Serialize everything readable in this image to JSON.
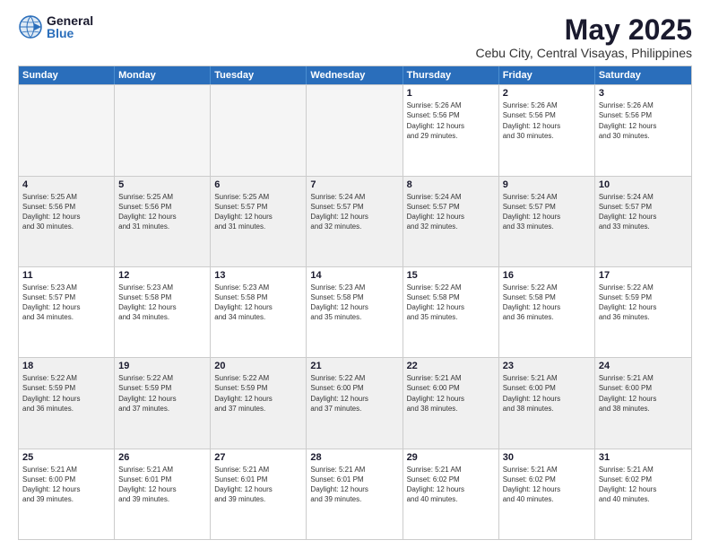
{
  "logo": {
    "general": "General",
    "blue": "Blue"
  },
  "title": "May 2025",
  "subtitle": "Cebu City, Central Visayas, Philippines",
  "days": [
    "Sunday",
    "Monday",
    "Tuesday",
    "Wednesday",
    "Thursday",
    "Friday",
    "Saturday"
  ],
  "weeks": [
    [
      {
        "day": "",
        "empty": true
      },
      {
        "day": "",
        "empty": true
      },
      {
        "day": "",
        "empty": true
      },
      {
        "day": "",
        "empty": true
      },
      {
        "day": "1",
        "info": "Sunrise: 5:26 AM\nSunset: 5:56 PM\nDaylight: 12 hours\nand 29 minutes."
      },
      {
        "day": "2",
        "info": "Sunrise: 5:26 AM\nSunset: 5:56 PM\nDaylight: 12 hours\nand 30 minutes."
      },
      {
        "day": "3",
        "info": "Sunrise: 5:26 AM\nSunset: 5:56 PM\nDaylight: 12 hours\nand 30 minutes."
      }
    ],
    [
      {
        "day": "4",
        "info": "Sunrise: 5:25 AM\nSunset: 5:56 PM\nDaylight: 12 hours\nand 30 minutes."
      },
      {
        "day": "5",
        "info": "Sunrise: 5:25 AM\nSunset: 5:56 PM\nDaylight: 12 hours\nand 31 minutes."
      },
      {
        "day": "6",
        "info": "Sunrise: 5:25 AM\nSunset: 5:57 PM\nDaylight: 12 hours\nand 31 minutes."
      },
      {
        "day": "7",
        "info": "Sunrise: 5:24 AM\nSunset: 5:57 PM\nDaylight: 12 hours\nand 32 minutes."
      },
      {
        "day": "8",
        "info": "Sunrise: 5:24 AM\nSunset: 5:57 PM\nDaylight: 12 hours\nand 32 minutes."
      },
      {
        "day": "9",
        "info": "Sunrise: 5:24 AM\nSunset: 5:57 PM\nDaylight: 12 hours\nand 33 minutes."
      },
      {
        "day": "10",
        "info": "Sunrise: 5:24 AM\nSunset: 5:57 PM\nDaylight: 12 hours\nand 33 minutes."
      }
    ],
    [
      {
        "day": "11",
        "info": "Sunrise: 5:23 AM\nSunset: 5:57 PM\nDaylight: 12 hours\nand 34 minutes."
      },
      {
        "day": "12",
        "info": "Sunrise: 5:23 AM\nSunset: 5:58 PM\nDaylight: 12 hours\nand 34 minutes."
      },
      {
        "day": "13",
        "info": "Sunrise: 5:23 AM\nSunset: 5:58 PM\nDaylight: 12 hours\nand 34 minutes."
      },
      {
        "day": "14",
        "info": "Sunrise: 5:23 AM\nSunset: 5:58 PM\nDaylight: 12 hours\nand 35 minutes."
      },
      {
        "day": "15",
        "info": "Sunrise: 5:22 AM\nSunset: 5:58 PM\nDaylight: 12 hours\nand 35 minutes."
      },
      {
        "day": "16",
        "info": "Sunrise: 5:22 AM\nSunset: 5:58 PM\nDaylight: 12 hours\nand 36 minutes."
      },
      {
        "day": "17",
        "info": "Sunrise: 5:22 AM\nSunset: 5:59 PM\nDaylight: 12 hours\nand 36 minutes."
      }
    ],
    [
      {
        "day": "18",
        "info": "Sunrise: 5:22 AM\nSunset: 5:59 PM\nDaylight: 12 hours\nand 36 minutes."
      },
      {
        "day": "19",
        "info": "Sunrise: 5:22 AM\nSunset: 5:59 PM\nDaylight: 12 hours\nand 37 minutes."
      },
      {
        "day": "20",
        "info": "Sunrise: 5:22 AM\nSunset: 5:59 PM\nDaylight: 12 hours\nand 37 minutes."
      },
      {
        "day": "21",
        "info": "Sunrise: 5:22 AM\nSunset: 6:00 PM\nDaylight: 12 hours\nand 37 minutes."
      },
      {
        "day": "22",
        "info": "Sunrise: 5:21 AM\nSunset: 6:00 PM\nDaylight: 12 hours\nand 38 minutes."
      },
      {
        "day": "23",
        "info": "Sunrise: 5:21 AM\nSunset: 6:00 PM\nDaylight: 12 hours\nand 38 minutes."
      },
      {
        "day": "24",
        "info": "Sunrise: 5:21 AM\nSunset: 6:00 PM\nDaylight: 12 hours\nand 38 minutes."
      }
    ],
    [
      {
        "day": "25",
        "info": "Sunrise: 5:21 AM\nSunset: 6:00 PM\nDaylight: 12 hours\nand 39 minutes."
      },
      {
        "day": "26",
        "info": "Sunrise: 5:21 AM\nSunset: 6:01 PM\nDaylight: 12 hours\nand 39 minutes."
      },
      {
        "day": "27",
        "info": "Sunrise: 5:21 AM\nSunset: 6:01 PM\nDaylight: 12 hours\nand 39 minutes."
      },
      {
        "day": "28",
        "info": "Sunrise: 5:21 AM\nSunset: 6:01 PM\nDaylight: 12 hours\nand 39 minutes."
      },
      {
        "day": "29",
        "info": "Sunrise: 5:21 AM\nSunset: 6:02 PM\nDaylight: 12 hours\nand 40 minutes."
      },
      {
        "day": "30",
        "info": "Sunrise: 5:21 AM\nSunset: 6:02 PM\nDaylight: 12 hours\nand 40 minutes."
      },
      {
        "day": "31",
        "info": "Sunrise: 5:21 AM\nSunset: 6:02 PM\nDaylight: 12 hours\nand 40 minutes."
      }
    ]
  ]
}
